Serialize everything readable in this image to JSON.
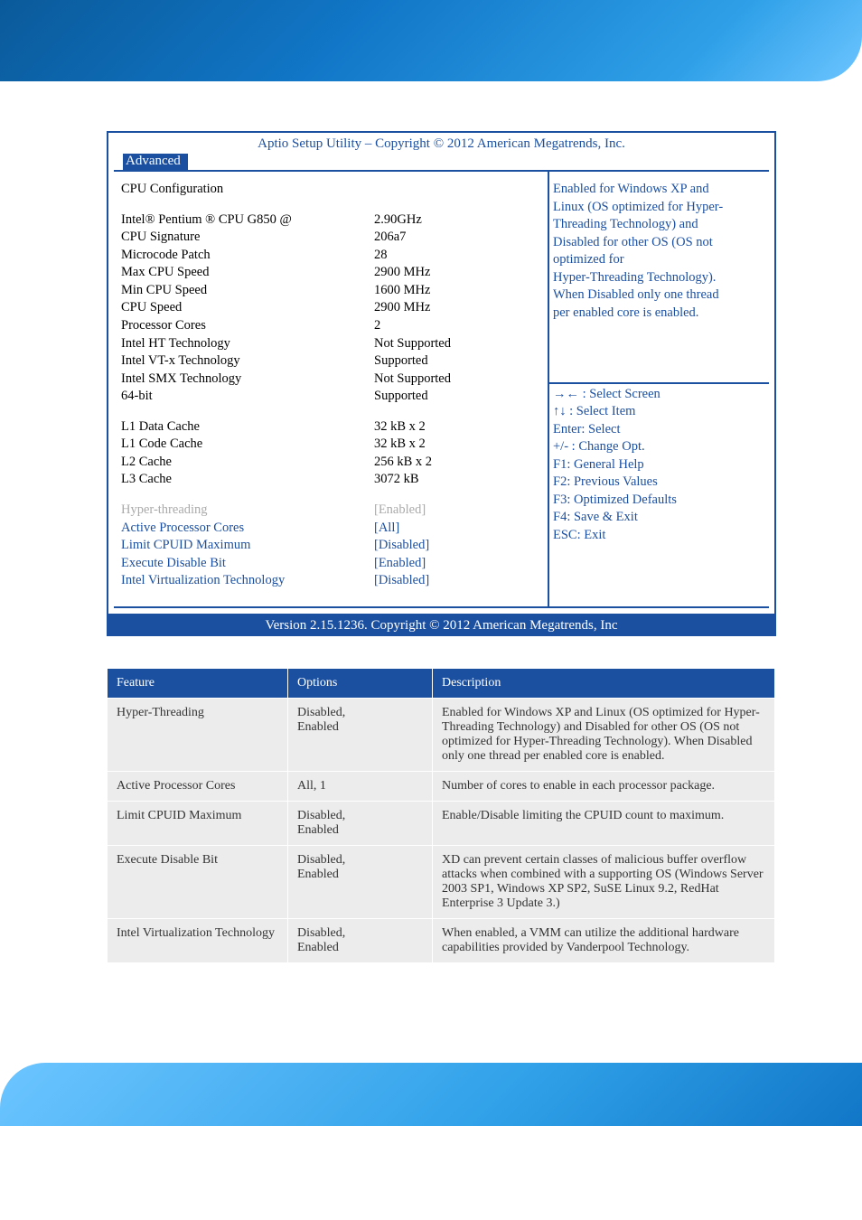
{
  "bios": {
    "title": "Aptio Setup Utility  –  Copyright © 2012 American Megatrends, Inc.",
    "tab": "Advanced",
    "section_heading": "CPU Configuration",
    "info_rows": [
      {
        "label": "Intel® Pentium ® CPU G850 @",
        "value": "2.90GHz"
      },
      {
        "label": "CPU Signature",
        "value": "206a7"
      },
      {
        "label": "Microcode Patch",
        "value": "28"
      },
      {
        "label": "Max CPU Speed",
        "value": "2900 MHz"
      },
      {
        "label": "Min CPU Speed",
        "value": "1600 MHz"
      },
      {
        "label": "CPU Speed",
        "value": "2900 MHz"
      },
      {
        "label": "Processor Cores",
        "value": "2"
      },
      {
        "label": "Intel HT Technology",
        "value": "Not Supported"
      },
      {
        "label": "Intel VT-x Technology",
        "value": "Supported"
      },
      {
        "label": "Intel SMX Technology",
        "value": "Not Supported"
      },
      {
        "label": "64-bit",
        "value": "Supported"
      }
    ],
    "cache_rows": [
      {
        "label": "L1 Data Cache",
        "value": "32 kB x 2"
      },
      {
        "label": "L1 Code Cache",
        "value": "32 kB x 2"
      },
      {
        "label": "L2 Cache",
        "value": "256 kB x 2"
      },
      {
        "label": "L3 Cache",
        "value": "3072 kB"
      }
    ],
    "option_rows": [
      {
        "label": "Hyper-threading",
        "value": "[Enabled]",
        "selected": true
      },
      {
        "label": "Active Processor Cores",
        "value": "[All]"
      },
      {
        "label": "Limit CPUID Maximum",
        "value": "[Disabled]"
      },
      {
        "label": "Execute Disable Bit",
        "value": "[Enabled]"
      },
      {
        "label": "Intel Virtualization Technology",
        "value": "[Disabled]"
      }
    ],
    "help_lines": [
      "Enabled for Windows XP and",
      "Linux (OS optimized for Hyper-",
      "Threading Technology) and",
      "Disabled for other OS (OS not",
      "optimized for",
      "Hyper-Threading Technology).",
      "When Disabled only one thread",
      "per enabled core is enabled."
    ],
    "key_lines": [
      "→← : Select Screen",
      "↑↓ : Select Item",
      "Enter: Select",
      "+/- : Change Opt.",
      "F1: General Help",
      "F2: Previous Values",
      "F3: Optimized Defaults",
      "F4: Save & Exit",
      "ESC: Exit"
    ],
    "footer": "Version 2.15.1236. Copyright © 2012 American Megatrends, Inc"
  },
  "table": {
    "headers": [
      "Feature",
      "Options",
      "Description"
    ],
    "rows": [
      {
        "feature": "Hyper-Threading",
        "options": "Disabled,\nEnabled",
        "desc": "Enabled for Windows XP and Linux (OS optimized for Hyper-Threading Technology) and Disabled for other OS (OS not optimized for Hyper-Threading Technology). When Disabled only one thread per enabled core is enabled."
      },
      {
        "feature": "Active Processor Cores",
        "options": "All, 1",
        "desc": "Number of cores to enable in each processor package."
      },
      {
        "feature": "Limit CPUID Maximum",
        "options": "Disabled,\nEnabled",
        "desc": "Enable/Disable limiting the CPUID count to maximum."
      },
      {
        "feature": "Execute Disable Bit",
        "options": "Disabled,\nEnabled",
        "desc": "XD can prevent certain classes of malicious buffer overflow attacks when combined with a supporting OS (Windows Server 2003 SP1, Windows XP SP2, SuSE Linux 9.2, RedHat Enterprise 3 Update 3.)"
      },
      {
        "feature": "Intel Virtualization Technology",
        "options": "Disabled,\nEnabled",
        "desc": "When enabled, a VMM can utilize the additional hardware capabilities provided by Vanderpool Technology."
      }
    ]
  }
}
